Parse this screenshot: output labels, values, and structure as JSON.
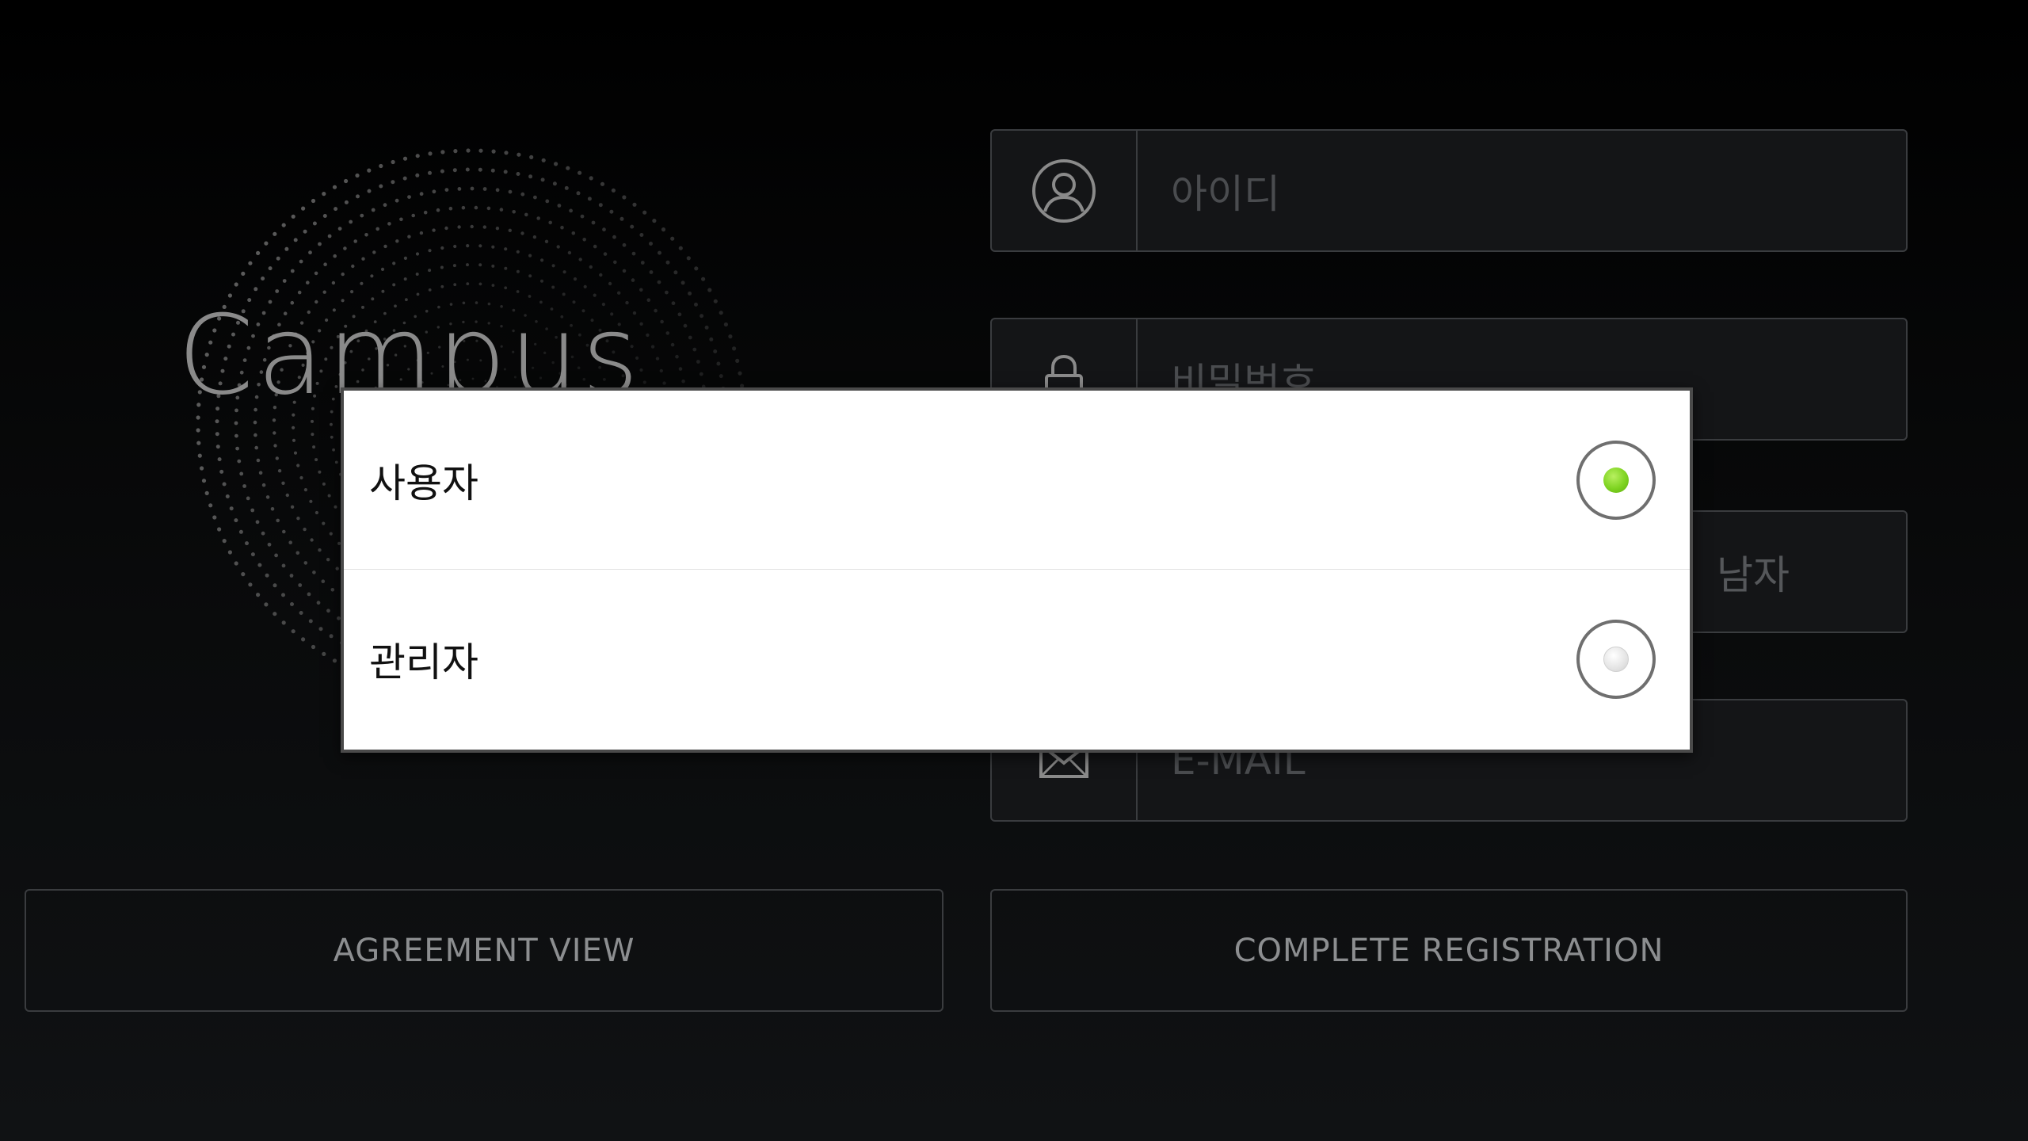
{
  "app": {
    "logo_text": "Campus"
  },
  "form": {
    "id_placeholder": "아이디",
    "password_placeholder": "비밀번호",
    "gender_value": "남자",
    "email_placeholder": "E-MAIL"
  },
  "buttons": {
    "agreement_label": "AGREEMENT VIEW",
    "complete_label": "COMPLETE REGISTRATION"
  },
  "dialog": {
    "options": [
      {
        "label": "사용자",
        "selected": true
      },
      {
        "label": "관리자",
        "selected": false
      }
    ]
  },
  "colors": {
    "background": "#000000",
    "field_border": "#3a3c3f",
    "selected_radio": "#7ed321",
    "dialog_background": "#ffffff"
  }
}
